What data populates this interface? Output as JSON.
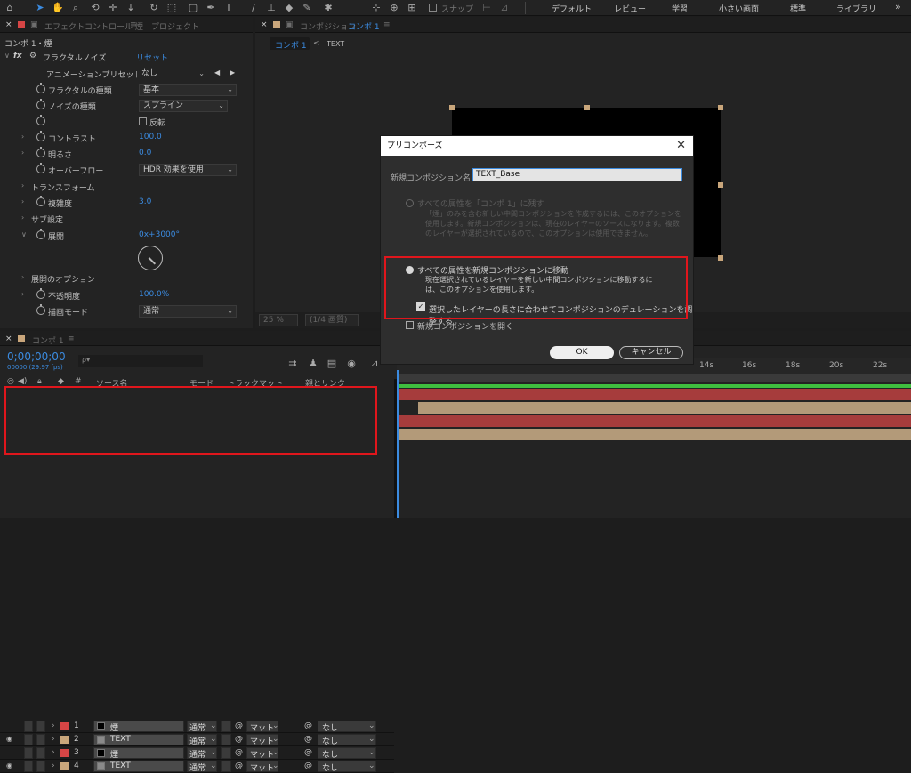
{
  "toolbar": {
    "snap_label": "スナップ",
    "workspaces": [
      "デフォルト",
      "レビュー",
      "学習",
      "小さい画面",
      "標準",
      "ライブラリ"
    ],
    "menu_icon": "»"
  },
  "effect_panel": {
    "tab_label": "エフェクトコントロール 煙",
    "tab_menu": "≡",
    "tab_project": "プロジェクト",
    "layer_path": "コンポ 1・煙",
    "fx_label": "fx",
    "effect_name": "フラクタルノイズ",
    "reset_label": "リセット",
    "preset_label": "アニメーションプリセット :",
    "preset_value": "なし",
    "properties": {
      "fractal_type_label": "フラクタルの種類",
      "fractal_type_value": "基本",
      "noise_type_label": "ノイズの種類",
      "noise_type_value": "スプライン",
      "invert_label": "反転",
      "contrast_label": "コントラスト",
      "contrast_value": "100.0",
      "brightness_label": "明るさ",
      "brightness_value": "0.0",
      "overflow_label": "オーバーフロー",
      "overflow_value": "HDR 効果を使用",
      "transform_label": "トランスフォーム",
      "complexity_label": "複雑度",
      "complexity_value": "3.0",
      "sub_settings_label": "サブ設定",
      "evolution_label": "展開",
      "evolution_value": "0x+3000°",
      "evolution_options_label": "展開のオプション",
      "opacity_label": "不透明度",
      "opacity_value": "100.0%",
      "blend_mode_label": "描画モード",
      "blend_mode_value": "通常"
    }
  },
  "comp_panel": {
    "tab_label": "コンポジション",
    "comp_name": "コンポ 1",
    "tab_menu": "≡",
    "breadcrumb_comp": "コンポ 1",
    "breadcrumb_arrow": "<",
    "breadcrumb_layer": "TEXT",
    "zoom": "25 %",
    "quality": "(1/4 画質)"
  },
  "dialog": {
    "title": "プリコンポーズ",
    "close": "✕",
    "name_label": "新規コンポジション名 :",
    "name_value": "TEXT_Base",
    "option1_label": "すべての属性を「コンポ 1」に残す",
    "option1_desc": "「煙」のみを含む新しい中間コンポジションを作成するには、このオプションを使用します。新規コンポジションは、現在のレイヤーのソースになります。複数のレイヤーが選択されているので、このオプションは使用できません。",
    "option2_label": "すべての属性を新規コンポジションに移動",
    "option2_desc": "現在選択されているレイヤーを新しい中間コンポジションに移動するには、このオプションを使用します。",
    "adjust_label": "選択したレイヤーの長さに合わせてコンポジションのデュレーションを調整する",
    "open_label": "新規コンポジションを開く",
    "ok_label": "OK",
    "cancel_label": "キャンセル"
  },
  "timeline": {
    "tab_label": "コンポ 1",
    "tab_menu": "≡",
    "timecode": "0;00;00;00",
    "timecode_fps": "00000 (29.97 fps)",
    "search_icon": "ρ▾",
    "columns": {
      "num": "#",
      "source": "ソース名",
      "mode": "モード",
      "trackmatte": "トラックマット",
      "parent": "親とリンク"
    },
    "ruler_ticks": [
      "14s",
      "16s",
      "18s",
      "20s",
      "22s"
    ],
    "layers": [
      {
        "num": "1",
        "name": "煙",
        "type": "solid",
        "label_color": "#d64545",
        "mode": "通常",
        "matte": "マット",
        "parent": "なし",
        "visible": false
      },
      {
        "num": "2",
        "name": "TEXT",
        "type": "comp",
        "label_color": "#c9a67b",
        "mode": "通常",
        "matte": "マット",
        "parent": "なし",
        "visible": true
      },
      {
        "num": "3",
        "name": "煙",
        "type": "solid",
        "label_color": "#d64545",
        "mode": "通常",
        "matte": "マット",
        "parent": "なし",
        "visible": false
      },
      {
        "num": "4",
        "name": "TEXT",
        "type": "comp",
        "label_color": "#c9a67b",
        "mode": "通常",
        "matte": "マット",
        "parent": "なし",
        "visible": true
      }
    ]
  },
  "colors": {
    "accent_blue": "#3b8be0",
    "highlight_red": "#e0161c",
    "solid_layer_bar": "#a63c3c",
    "comp_layer_bar": "#b39a79"
  }
}
